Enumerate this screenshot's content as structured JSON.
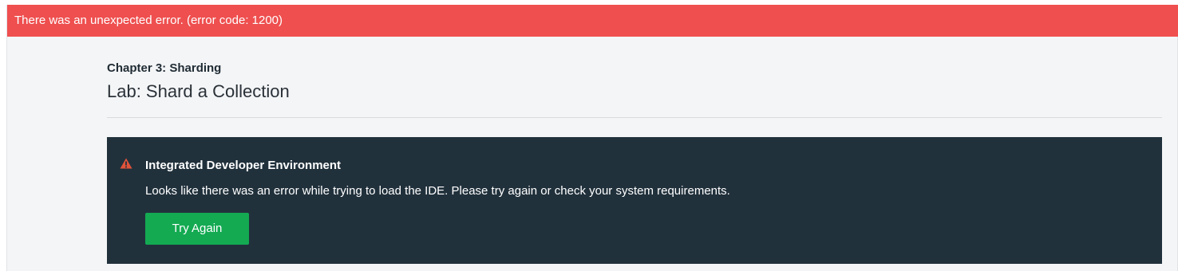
{
  "error_banner": {
    "text": "There was an unexpected error. (error code: 1200)"
  },
  "header": {
    "chapter": "Chapter 3: Sharding",
    "title": "Lab: Shard a Collection"
  },
  "ide_panel": {
    "icon": "warning-triangle-icon",
    "title": "Integrated Developer Environment",
    "message": "Looks like there was an error while trying to load the IDE. Please try again or check your system requirements.",
    "button_label": "Try Again"
  },
  "colors": {
    "error_banner": "#ef4f4f",
    "panel_background": "#21313c",
    "button": "#13aa52",
    "warning_icon": "#e0533a"
  }
}
